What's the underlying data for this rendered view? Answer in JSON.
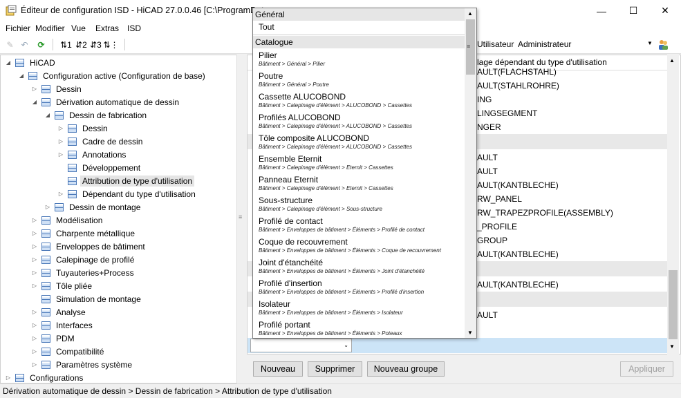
{
  "window": {
    "title": "Éditeur de configuration ISD  - HiCAD 27.0.0.46 [C:\\ProgramData",
    "minimize": "—",
    "maximize": "☐",
    "close": "✕"
  },
  "menu": [
    "Fichier",
    "Modifier",
    "Vue",
    "Extras",
    "ISD"
  ],
  "toolbar": {
    "user_label": "Utilisateur",
    "user_value": "Administrateur"
  },
  "tree": [
    {
      "label": "HiCAD",
      "expanded": true
    },
    {
      "label": "Configuration active (Configuration de base)",
      "expanded": true
    },
    {
      "label": "Dessin",
      "expanded": false
    },
    {
      "label": "Dérivation automatique de dessin",
      "expanded": true
    },
    {
      "label": "Dessin de fabrication",
      "expanded": true
    },
    {
      "label": "Dessin",
      "expanded": false
    },
    {
      "label": "Cadre de dessin",
      "expanded": false
    },
    {
      "label": "Annotations",
      "expanded": false
    },
    {
      "label": "Développement"
    },
    {
      "label": "Attribution de type d'utilisation",
      "selected": true
    },
    {
      "label": "Dépendant du type d'utilisation",
      "expanded": false
    },
    {
      "label": "Dessin de montage",
      "expanded": false
    },
    {
      "label": "Modélisation",
      "expanded": false
    },
    {
      "label": "Charpente métallique",
      "expanded": false
    },
    {
      "label": "Enveloppes de bâtiment",
      "expanded": false
    },
    {
      "label": "Calepinage de profilé",
      "expanded": false
    },
    {
      "label": "Tuyauteries+Process",
      "expanded": false
    },
    {
      "label": "Tôle pliée",
      "expanded": false
    },
    {
      "label": "Simulation de montage"
    },
    {
      "label": "Analyse",
      "expanded": false
    },
    {
      "label": "Interfaces",
      "expanded": false
    },
    {
      "label": "PDM",
      "expanded": false
    },
    {
      "label": "Compatibilité",
      "expanded": false
    },
    {
      "label": "Paramètres système",
      "expanded": false
    },
    {
      "label": "Configurations",
      "expanded": false
    }
  ],
  "grid": {
    "header": "lage dépendant du type d'utilisation",
    "rows": [
      "AULT(FLACHSTAHL)",
      "AULT(STAHLROHRE)",
      "ING",
      "LINGSEGMENT",
      "NGER",
      "",
      "AULT",
      "AULT",
      "AULT(KANTBLECHE)",
      "RW_PANEL",
      "RW_TRAPEZPROFILE(ASSEMBLY)",
      "_PROFILE",
      "GROUP",
      "AULT(KANTBLECHE)",
      "",
      "AULT(KANTBLECHE)",
      "",
      "AULT"
    ]
  },
  "buttons": {
    "new": "Nouveau",
    "delete": "Supprimer",
    "new_group": "Nouveau groupe",
    "apply": "Appliquer"
  },
  "status": "Dérivation automatique de dessin > Dessin de fabrication > Attribution de type d'utilisation",
  "dropdown": {
    "group_general": "Général",
    "item_all": "Tout",
    "group_catalogue": "Catalogue",
    "items": [
      {
        "name": "Pilier",
        "path": "Bâtiment > Général > Pilier"
      },
      {
        "name": "Poutre",
        "path": "Bâtiment > Général > Poutre"
      },
      {
        "name": "Cassette ALUCOBOND",
        "path": "Bâtiment > Calepinage d'élément > ALUCOBOND > Cassettes"
      },
      {
        "name": "Profilés ALUCOBOND",
        "path": "Bâtiment > Calepinage d'élément > ALUCOBOND > Cassettes"
      },
      {
        "name": "Tôle composite ALUCOBOND",
        "path": "Bâtiment > Calepinage d'élément > ALUCOBOND > Cassettes"
      },
      {
        "name": "Ensemble Eternit",
        "path": "Bâtiment > Calepinage d'élément > Eternit > Cassettes"
      },
      {
        "name": "Panneau Eternit",
        "path": "Bâtiment > Calepinage d'élément > Eternit > Cassettes"
      },
      {
        "name": "Sous-structure",
        "path": "Bâtiment > Calepinage d'élément > Sous-structure"
      },
      {
        "name": "Profilé de contact",
        "path": "Bâtiment > Enveloppes de bâtiment > Éléments > Profilé de contact"
      },
      {
        "name": "Coque de recouvrement",
        "path": "Bâtiment > Enveloppes de bâtiment > Éléments > Coque de recouvrement"
      },
      {
        "name": "Joint d'étanchéité",
        "path": "Bâtiment > Enveloppes de bâtiment > Éléments > Joint d'étanchéité"
      },
      {
        "name": "Profilé d'insertion",
        "path": "Bâtiment > Enveloppes de bâtiment > Éléments > Profilé d'insertion"
      },
      {
        "name": "Isolateur",
        "path": "Bâtiment > Enveloppes de bâtiment > Éléments > Isolateur"
      },
      {
        "name": "Profilé portant",
        "path": "Bâtiment > Enveloppes de bâtiment > Éléments > Poteaux"
      }
    ]
  }
}
